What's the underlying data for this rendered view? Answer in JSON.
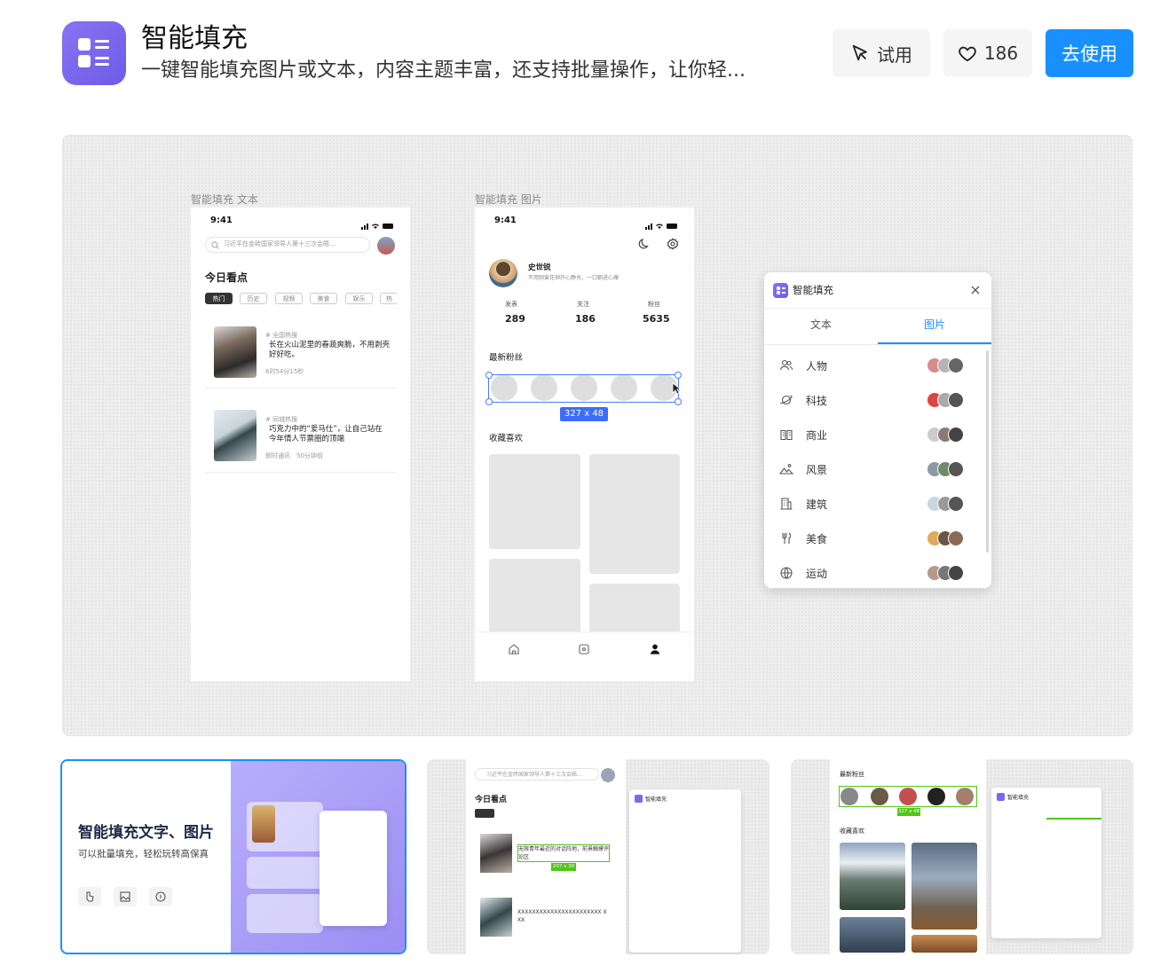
{
  "header": {
    "title": "智能填充",
    "description": "一键智能填充图片或文本，内容主题丰富，还支持批量操作，让你轻...",
    "try_label": "试用",
    "like_count": "186",
    "use_label": "去使用"
  },
  "preview": {
    "text_frame": {
      "label": "智能填充 文本",
      "time": "9:41",
      "search_text": "习近平在金砖国家领导人第十三次会晤...",
      "section_title": "今日看点",
      "tabs": [
        "热门",
        "历史",
        "视频",
        "美食",
        "娱乐",
        "热"
      ],
      "news": [
        {
          "tag": "# 全国热搜",
          "title": "长在火山泥里的春蔬爽脆，不用剥壳好好吃。",
          "meta": "6时54分15秒"
        },
        {
          "tag": "# 同城热搜",
          "title": "巧克力中的“爱马仕”，让自己站在今年情人节票圈的顶端",
          "meta": "即时通讯　50分钟前"
        }
      ]
    },
    "image_frame": {
      "label": "智能填充 图片",
      "time": "9:41",
      "name": "史世锐",
      "bio": "不用刚爱花钟开心静兑，一口朝进心爆",
      "stats": [
        {
          "label": "发表",
          "value": "289"
        },
        {
          "label": "关注",
          "value": "186"
        },
        {
          "label": "粉丝",
          "value": "5635"
        }
      ],
      "fans_title": "最新粉丝",
      "selection_size": "327 x 48",
      "fav_title": "收藏喜欢"
    },
    "panel": {
      "title": "智能填充",
      "tabs": [
        "文本",
        "图片"
      ],
      "active_tab": "图片",
      "categories": [
        "人物",
        "科技",
        "商业",
        "风景",
        "建筑",
        "美食",
        "运动"
      ],
      "accent": "#1890ff"
    }
  },
  "thumbnails": {
    "first": {
      "title": "智能填充文字、图片",
      "subtitle": "可以批量填充，轻松玩转高保真"
    },
    "second": {
      "search_text": "习近平在金砖国家领导人第十三次会晤...",
      "section_title": "今日看点",
      "news1": "无限青年最近的对话阵地，前景触摸评论区",
      "news2": "XXXXXXXXXXXXXXXXXXXXXXX XXX",
      "size_badge": "207 x 30",
      "panel_title": "智能填充"
    },
    "third": {
      "fans_title": "最新粉丝",
      "fav_title": "收藏喜欢",
      "size_badge": "327 x 48",
      "panel_title": "智能填充"
    }
  }
}
